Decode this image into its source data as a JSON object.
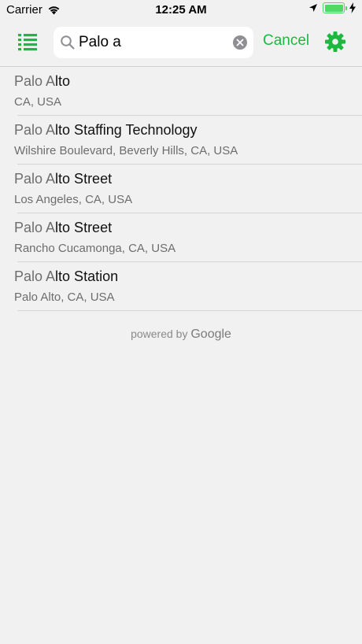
{
  "status_bar": {
    "carrier": "Carrier",
    "time": "12:25 AM",
    "battery_level": 1.0,
    "accent_color": "#4cd964"
  },
  "nav": {
    "list_icon": "list-icon",
    "search_icon": "search-icon",
    "search_value": "Palo a",
    "clear_icon": "clear-icon",
    "cancel_label": "Cancel",
    "settings_icon": "gear-icon",
    "accent_color": "#1db83f"
  },
  "results": [
    {
      "match": "Palo A",
      "rest": "lto",
      "subtitle": "CA, USA"
    },
    {
      "match": "Palo A",
      "rest": "lto Staffing Technology",
      "subtitle": "Wilshire Boulevard, Beverly Hills, CA, USA"
    },
    {
      "match": "Palo A",
      "rest": "lto Street",
      "subtitle": "Los Angeles, CA, USA"
    },
    {
      "match": "Palo A",
      "rest": "lto Street",
      "subtitle": "Rancho Cucamonga, CA, USA"
    },
    {
      "match": "Palo A",
      "rest": "lto Station",
      "subtitle": "Palo Alto, CA, USA"
    }
  ],
  "footer": {
    "powered_by": "powered by",
    "brand": "Google"
  }
}
